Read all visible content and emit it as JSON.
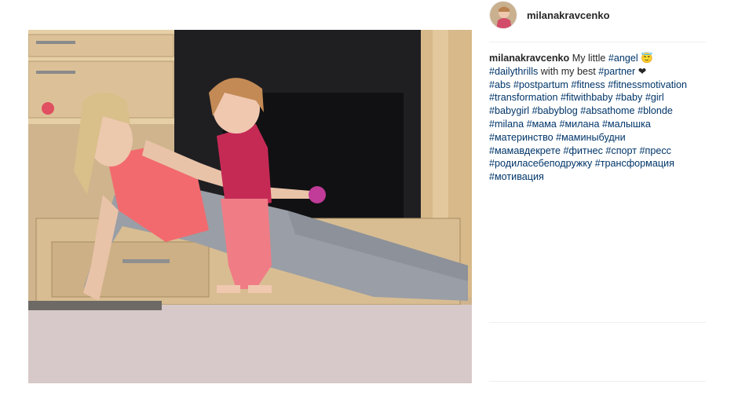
{
  "post": {
    "username": "milanakravcenko",
    "avatar_icon": "profile-avatar",
    "photo_icon": "post-photo",
    "caption": {
      "author": "milanakravcenko",
      "line1_text": " My little ",
      "line1_tag": "#angel",
      "line1_emoji": " 😇",
      "line2_tag1": "#dailythrills",
      "line2_text": " with my best ",
      "line2_tag2": "#partner",
      "line2_heart": " ❤",
      "line3": [
        "#abs",
        "#postpartum",
        "#fitness",
        "#fitnessmotivation"
      ],
      "line4": [
        "#transformation",
        "#fitwithbaby",
        "#baby",
        "#girl"
      ],
      "line5": [
        "#babygirl",
        "#babyblog",
        "#absathome",
        "#blonde"
      ],
      "line6": [
        "#milana",
        "#мама",
        "#милана",
        "#малышка"
      ],
      "line7": [
        "#материнство",
        "#маминыбудни"
      ],
      "line8": [
        "#мамавдекрете",
        "#фитнес",
        "#спорт",
        "#пресс"
      ],
      "line9": [
        "#родиласебеподружку",
        "#трансформация"
      ],
      "line10": [
        "#мотивация"
      ]
    },
    "colors": {
      "hashtag": "#003569",
      "text": "#262626",
      "divider": "#efefef"
    }
  }
}
